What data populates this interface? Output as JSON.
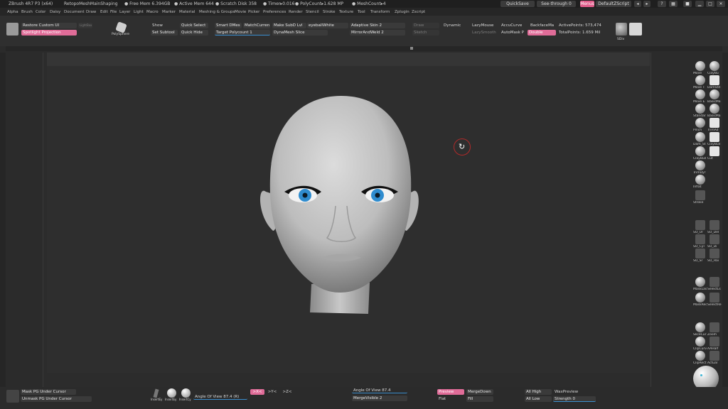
{
  "titlebar": {
    "app": "ZBrush 4R7 P3 (x64)",
    "document": "RetopoMeshMainShaping",
    "free_mem": "● Free Mem 6.394GB",
    "active_mem": "● Active Mem 644",
    "scratch_disk": "● Scratch Disk 358",
    "timer": "● Timer▸0.016",
    "polycount": "● PolyCount▸1.628 MP",
    "meshcount": "● MeshCount▸4",
    "quicksave": "QuickSave",
    "see_through": "See-through  0",
    "menus": "Menus",
    "default_zscript": "DefaultZScript"
  },
  "menubar": [
    "Alpha",
    "Brush",
    "Color",
    "Daisy",
    "Document",
    "Draw",
    "Edit",
    "File",
    "Layer",
    "Light",
    "Macro",
    "Marker",
    "Material",
    "Movie",
    "Picker",
    "Preferences",
    "Render",
    "Stencil",
    "Stroke",
    "Texture",
    "Tool",
    "Transform",
    "Zplugin",
    "Zscript"
  ],
  "menubar_extra": "Meshing & Groups",
  "topshelf": {
    "restore_custom_ui": "Restore Custom UI",
    "spotlight_projection": "Spotlight Projection",
    "lightbox_label": "LightBox",
    "polysphere": "PolySphere",
    "show": "Show",
    "set_subtool": "Set Subtool",
    "quick_select": "Quick Select",
    "quick_hide": "Quick Hide",
    "smart_dmes": "Smart DMes",
    "matchcurrent": "MatchCurren",
    "target_polycount": "Target Polycount 1",
    "make_subd_lvl": "Make SubD Lvl",
    "eyeball_white": "eyeballWhite",
    "dynamesh_slice": "DynaMesh Slice",
    "adaptive_skin": "Adaptive Skin 2",
    "mirror_and_weld": "MirrorAndWeld 2",
    "draw": "Draw",
    "sketch": "Sketch",
    "dynamic": "Dynamic",
    "lazymouse": "LazyMouse",
    "lazysmooth": "LazySmooth",
    "accucurve": "AccuCurve",
    "automask": "AutoMask P",
    "double": "Double",
    "backface_mask": "BackfaceMa",
    "active_points": "ActivePoints: 573,474",
    "total_points": "TotalPoints: 1.659 Mil",
    "sdiv": "SDiv"
  },
  "bottombar": {
    "mask_pg_under_cursor": "Mask PG Under Cursor",
    "unmask_pg_under_cursor": "Unmask PG Under Cursor",
    "angle_of_view_left": "Angle Of View 87.4 (R)",
    "angle_of_view_right": "Angle Of View 87.4",
    "x_button": ">X<",
    "y_button": ">Y<",
    "z_button": ">Z<",
    "merge_visible": "MergeVisible 2",
    "preview": "Preview",
    "merge_down": "MergeDown",
    "flat": "Flat",
    "fill": "Fill",
    "all_high": "All High",
    "all_low": "All Low",
    "wax_preview": "WaxPreview",
    "strength": "Strength 0",
    "insert_labels": [
      "InsertEy",
      "InsertEy",
      "InsertCy"
    ]
  },
  "rightshelf": {
    "brushes": [
      "Move",
      "ClayBu",
      "Move T",
      "DamStd",
      "Move E",
      "BasicMa",
      "Standar",
      "BasicMa",
      "Pinch",
      "TrimAd",
      "Dam_St",
      "ClayBuil",
      "ClayBuil",
      "Flat",
      "Cut",
      "TrimDyr",
      "Inflat",
      "Stroke"
    ],
    "tools": [
      "SO_Ur",
      "SO_Del",
      "SO_Cyl",
      "SO_Di",
      "SO_Sr",
      "SO_Hai"
    ],
    "masks": [
      "MaskLas",
      "SelectLs",
      "MaskRec",
      "SelectRe"
    ],
    "clips": [
      "SliceCur",
      "Zoom",
      "ClipCurv",
      "AAHalf",
      "ClipRect",
      "Actual"
    ]
  },
  "colors": {
    "accent_pink": "#e06c98",
    "rotate_ring": "#b12a2a",
    "eye_blue": "#2f8ccf"
  }
}
